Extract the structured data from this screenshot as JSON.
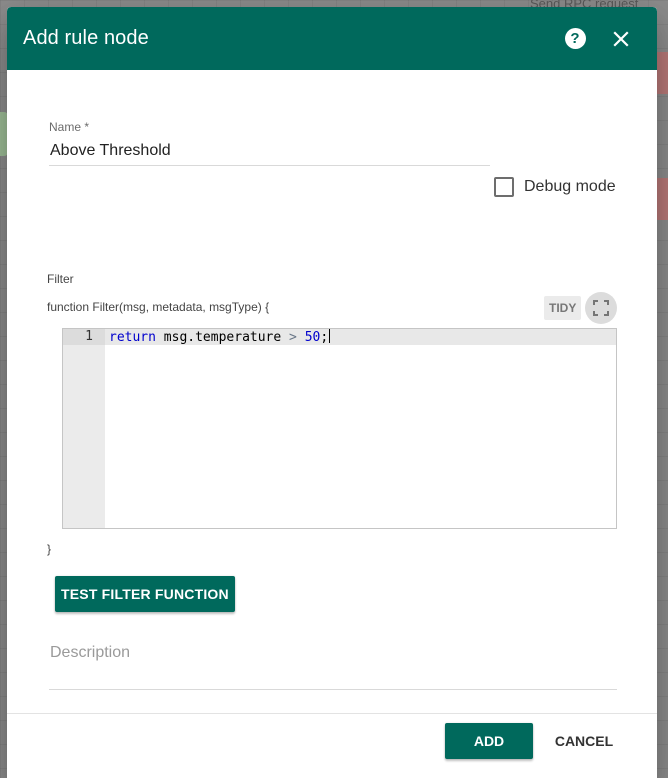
{
  "background": {
    "node_label": "Send RPC request"
  },
  "dialog": {
    "title": "Add rule node",
    "help_icon": "help-circle-icon",
    "close_icon": "close-icon",
    "accent_color": "#00695c"
  },
  "name_field": {
    "label": "Name",
    "required_marker": "*",
    "value": "Above Threshold"
  },
  "debug_mode": {
    "label": "Debug mode",
    "checked": false
  },
  "filter": {
    "title": "Filter",
    "signature": "function Filter(msg, metadata, msgType) {",
    "tidy_label": "TIDY",
    "fullscreen_icon": "fullscreen-icon",
    "editor": {
      "line_number": "1",
      "code_keyword": "return",
      "code_object": "msg.temperature",
      "code_operator": ">",
      "code_value": "50",
      "code_end": ";"
    },
    "closing": "}"
  },
  "test_button_label": "TEST FILTER FUNCTION",
  "description": {
    "placeholder": "Description",
    "value": ""
  },
  "footer": {
    "add_label": "ADD",
    "cancel_label": "CANCEL"
  }
}
